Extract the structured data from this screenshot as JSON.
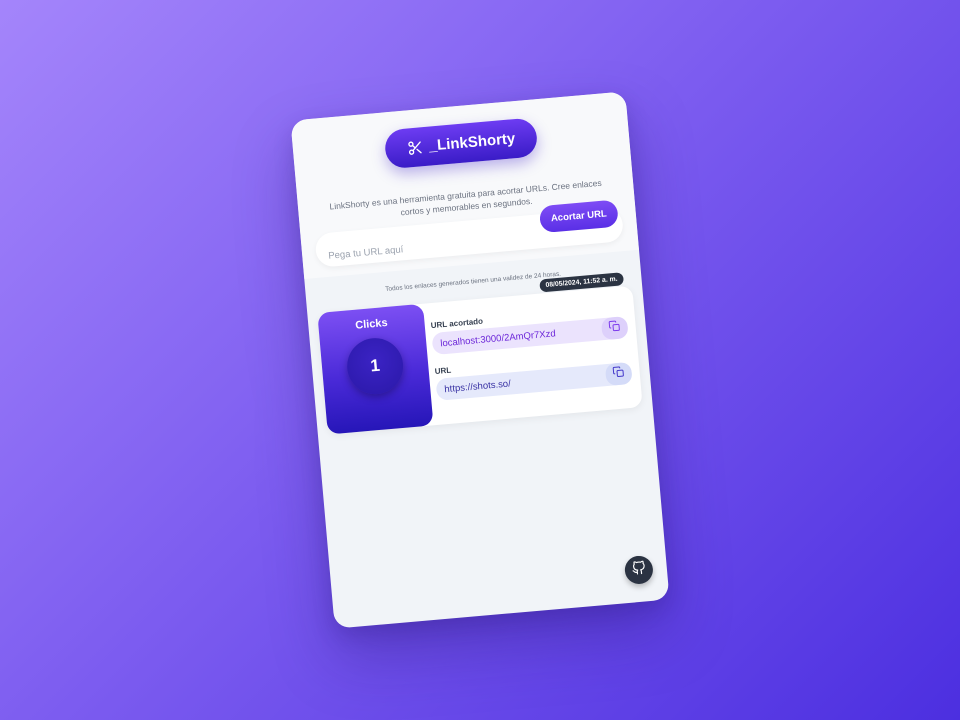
{
  "app": {
    "logo_text": "_LinkShorty",
    "logo_icon": "scissors-icon",
    "description": "LinkShorty es una herramienta gratuita para acortar URLs. Cree enlaces cortos y memorables en segundos."
  },
  "form": {
    "url_value": "",
    "url_placeholder": "Pega tu URL aquí",
    "submit_label": "Acortar URL"
  },
  "validity_note": "Todos los enlaces generados tienen una validez de 24 horas.",
  "links": [
    {
      "date": "08/05/2024, 11:52 a. m.",
      "clicks_label": "Clicks",
      "clicks": "1",
      "short_label": "URL acortado",
      "short_url": "localhost:3000/2AmQr7Xzd",
      "original_label": "URL",
      "original_url": "https://shots.so/"
    }
  ],
  "footer": {
    "github_icon": "github-icon"
  },
  "colors": {
    "accent": "#5a2fe6",
    "accent_dark": "#3a1cc7",
    "badge": "#2b3342",
    "short_url_text": "#6d28d9",
    "original_url_text": "#3730a3"
  }
}
